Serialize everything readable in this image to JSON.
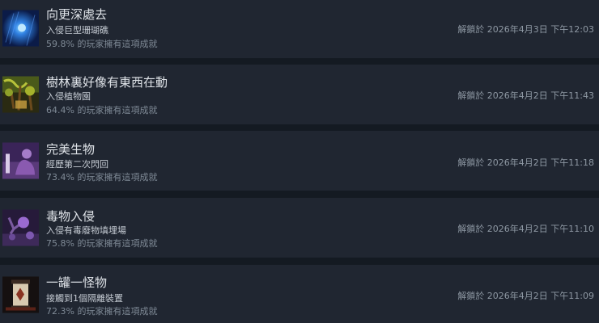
{
  "achievements": [
    {
      "icon": "blue-orb-icon",
      "title": "向更深處去",
      "description": "入侵巨型珊瑚礁",
      "percent": "59.8% 的玩家擁有這項成就",
      "unlocked": "解鎖於 2026年4月3日 下午12:03"
    },
    {
      "icon": "forest-vines-icon",
      "title": "樹林裏好像有東西在動",
      "description": "入侵植物園",
      "percent": "64.4% 的玩家擁有這項成就",
      "unlocked": "解鎖於 2026年4月2日 下午11:43"
    },
    {
      "icon": "purple-creature-icon",
      "title": "完美生物",
      "description": "經歷第二次閃回",
      "percent": "73.4% 的玩家擁有這項成就",
      "unlocked": "解鎖於 2026年4月2日 下午11:18"
    },
    {
      "icon": "toxic-flower-icon",
      "title": "毒物入侵",
      "description": "入侵有毒廢物填埋場",
      "percent": "75.8% 的玩家擁有這項成就",
      "unlocked": "解鎖於 2026年4月2日 下午11:10"
    },
    {
      "icon": "containment-jar-icon",
      "title": "一罐一怪物",
      "description": "接觸到1個隔離裝置",
      "percent": "72.3% 的玩家擁有這項成就",
      "unlocked": "解鎖於 2026年4月2日 下午11:09"
    }
  ]
}
